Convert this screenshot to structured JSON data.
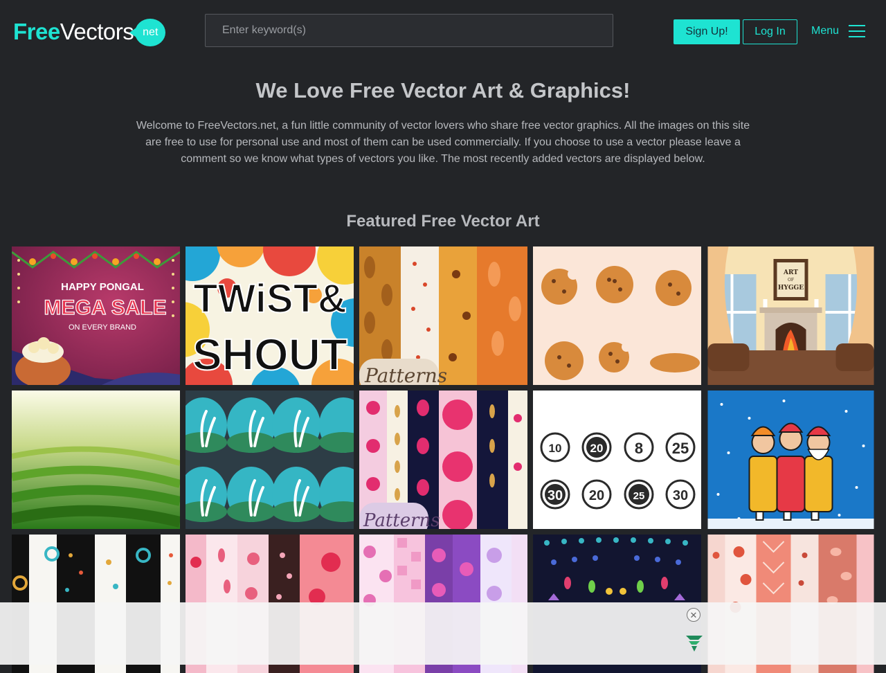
{
  "header": {
    "logo_free": "Free",
    "logo_vectors": "Vectors",
    "logo_net": "net",
    "search_placeholder": "Enter keyword(s)",
    "signup_label": "Sign Up!",
    "login_label": "Log In",
    "menu_label": "Menu"
  },
  "intro": {
    "title": "We Love Free Vector Art & Graphics!",
    "text": "Welcome to FreeVectors.net, a fun little community of vector lovers who share free vector graphics. All the images on this site are free to use for personal use and most of them can be used commercially. If you choose to use a vector please leave a comment so we know what types of vectors you like. The most recently added vectors are displayed below."
  },
  "featured": {
    "title": "Featured Free Vector Art",
    "tiles": [
      {
        "text_lines": [
          "HAPPY PONGAL",
          "MEGA SALE",
          "ON EVERY BRAND"
        ]
      },
      {
        "text_lines": [
          "TWiST&",
          "SHOUT"
        ]
      },
      {
        "text_lines": [
          "Patterns"
        ]
      },
      {
        "text_lines": []
      },
      {
        "text_lines": [
          "ART",
          "OF",
          "HYGGE"
        ]
      },
      {
        "text_lines": []
      },
      {
        "text_lines": []
      },
      {
        "text_lines": [
          "Patterns"
        ]
      },
      {
        "text_lines": [
          "10",
          "20",
          "8",
          "25",
          "30",
          "20",
          "25",
          "30"
        ]
      },
      {
        "text_lines": []
      },
      {
        "text_lines": []
      },
      {
        "text_lines": []
      },
      {
        "text_lines": []
      },
      {
        "text_lines": []
      },
      {
        "text_lines": []
      }
    ]
  },
  "colors": {
    "background": "#232528",
    "accent": "#1ee3d2"
  },
  "icons": {
    "menu": "hamburger-icon",
    "ad_close": "close-icon",
    "ad_brand": "freestar-logo-icon"
  }
}
